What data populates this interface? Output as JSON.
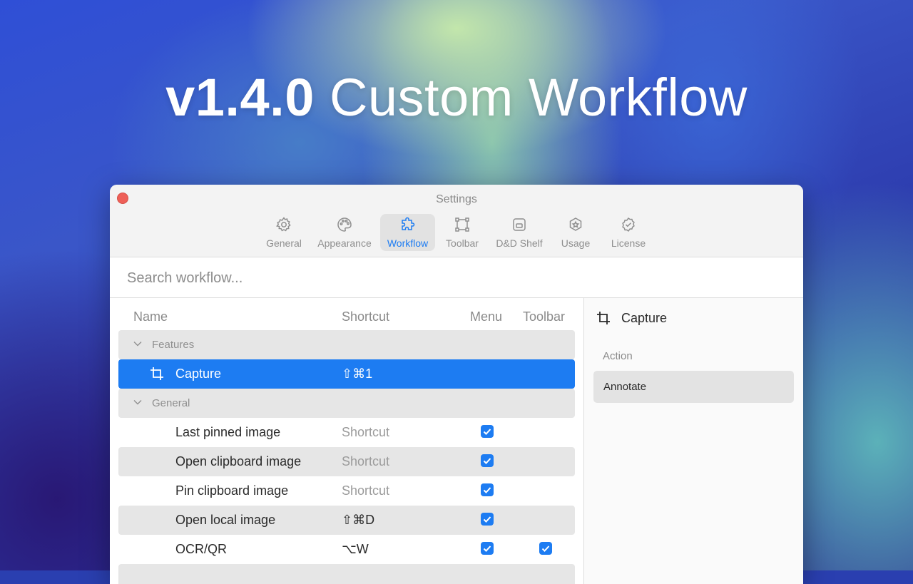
{
  "headline": {
    "version": "v1.4.0",
    "title": "Custom Workflow"
  },
  "window": {
    "title": "Settings",
    "tabs": [
      {
        "label": "General",
        "icon": "gear-icon"
      },
      {
        "label": "Appearance",
        "icon": "palette-icon"
      },
      {
        "label": "Workflow",
        "icon": "puzzle-icon",
        "active": true
      },
      {
        "label": "Toolbar",
        "icon": "toolbar-frame-icon"
      },
      {
        "label": "D&D Shelf",
        "icon": "shelf-icon"
      },
      {
        "label": "Usage",
        "icon": "badge-star-icon"
      },
      {
        "label": "License",
        "icon": "badge-check-icon"
      }
    ]
  },
  "search": {
    "placeholder": "Search workflow..."
  },
  "table": {
    "columns": {
      "name": "Name",
      "shortcut": "Shortcut",
      "menu": "Menu",
      "toolbar": "Toolbar"
    },
    "groups": {
      "features": "Features",
      "general": "General"
    },
    "rows": [
      {
        "name": "Capture",
        "shortcut": "⇧⌘1",
        "icon": "crop-icon",
        "selected": true
      },
      {
        "name": "Last pinned image",
        "shortcut": "Shortcut",
        "menu": true,
        "toolbar": false
      },
      {
        "name": "Open clipboard image",
        "shortcut": "Shortcut",
        "menu": true,
        "toolbar": false
      },
      {
        "name": "Pin clipboard image",
        "shortcut": "Shortcut",
        "menu": true,
        "toolbar": false
      },
      {
        "name": "Open local image",
        "shortcut": "⇧⌘D",
        "menu": true,
        "toolbar": false
      },
      {
        "name": "OCR/QR",
        "shortcut": "⌥W",
        "menu": true,
        "toolbar": true
      }
    ]
  },
  "detail": {
    "title": "Capture",
    "icon": "crop-icon",
    "action_label": "Action",
    "actions": [
      "Annotate"
    ]
  },
  "colors": {
    "accent": "#1d7cf2",
    "close": "#ee5f57"
  }
}
